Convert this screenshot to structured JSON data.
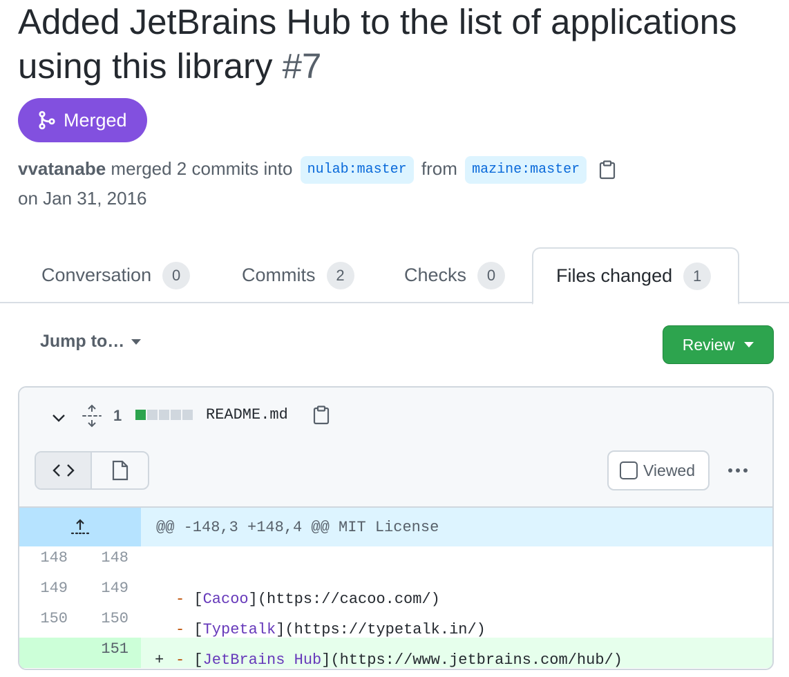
{
  "pr": {
    "title": "Added JetBrains Hub to the list of applications using this library",
    "number": "#7",
    "state": "Merged",
    "author": "vvatanabe",
    "action": "merged 2 commits into",
    "base_branch": "nulab:master",
    "from_word": "from",
    "head_branch": "mazine:master",
    "date": "on Jan 31, 2016"
  },
  "tabs": [
    {
      "label": "Conversation",
      "count": "0"
    },
    {
      "label": "Commits",
      "count": "2"
    },
    {
      "label": "Checks",
      "count": "0"
    },
    {
      "label": "Files changed",
      "count": "1"
    }
  ],
  "toolbar": {
    "jump_label": "Jump to…",
    "review_label": "Review"
  },
  "file": {
    "change_count": "1",
    "name": "README.md",
    "viewed_label": "Viewed",
    "hunk_header": "@@ -148,3 +148,4 @@ MIT License",
    "lines": [
      {
        "old": "148",
        "new": "148",
        "type": "context",
        "dash": "",
        "link": "",
        "url": ""
      },
      {
        "old": "149",
        "new": "149",
        "type": "context",
        "dash": "-",
        "link": "Cacoo",
        "url": "](https://cacoo.com/)"
      },
      {
        "old": "150",
        "new": "150",
        "type": "context",
        "dash": "-",
        "link": "Typetalk",
        "url": "](https://typetalk.in/)"
      },
      {
        "old": "",
        "new": "151",
        "type": "added",
        "marker": "+",
        "dash": "-",
        "link": "JetBrains Hub",
        "url": "](https://www.jetbrains.com/hub/)"
      }
    ]
  },
  "colors": {
    "merged": "#8250df",
    "review": "#2da44e",
    "added_bg": "#e6ffec",
    "hunk_bg": "#ddf4ff"
  }
}
